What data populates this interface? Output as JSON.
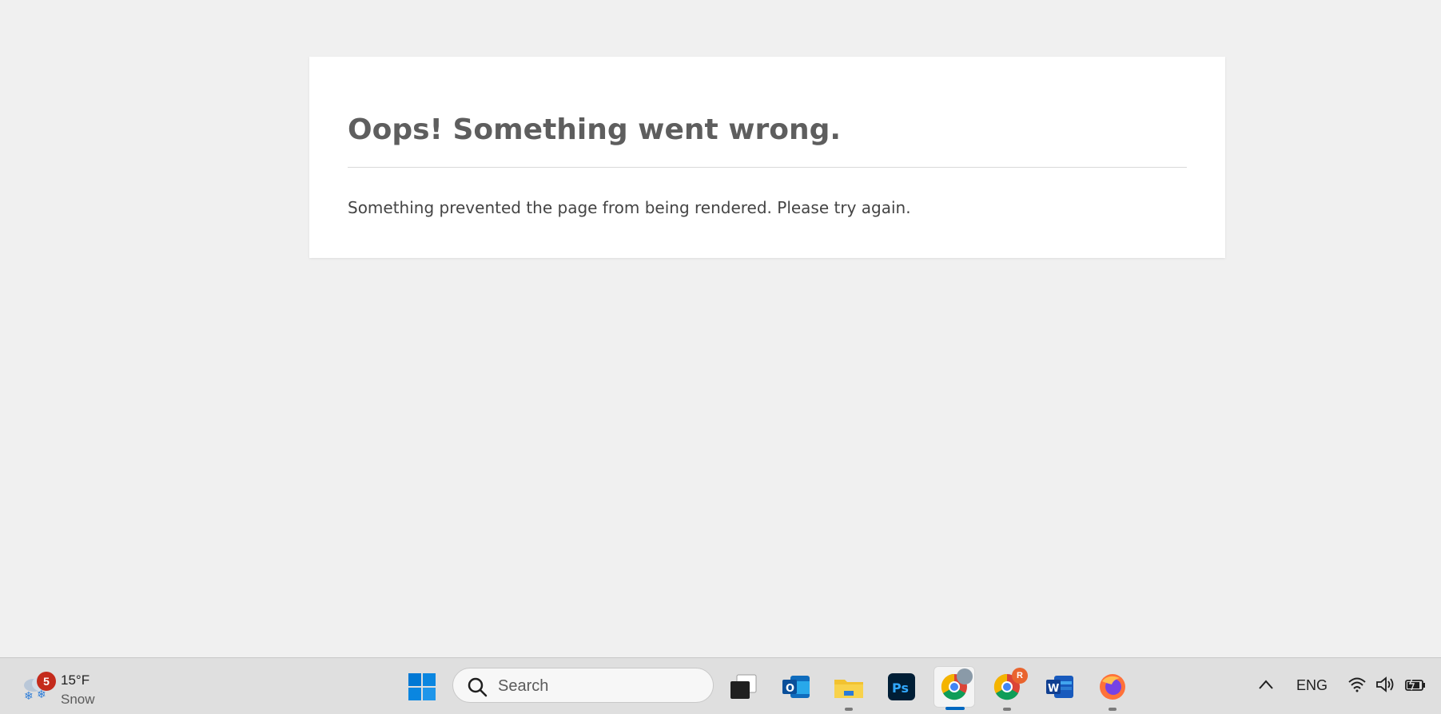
{
  "error_page": {
    "title": "Oops! Something went wrong.",
    "message": "Something prevented the page from being rendered. Please try again."
  },
  "taskbar": {
    "weather": {
      "temperature": "15°F",
      "condition": "Snow",
      "notification_count": "5",
      "icon": "snow-cloud-icon"
    },
    "search": {
      "placeholder": "Search"
    },
    "apps": [
      {
        "name": "Windows Start",
        "icon": "windows-start-icon"
      },
      {
        "name": "Task View",
        "icon": "task-view-icon"
      },
      {
        "name": "Outlook",
        "icon": "outlook-icon"
      },
      {
        "name": "File Explorer",
        "icon": "file-explorer-icon"
      },
      {
        "name": "Photoshop",
        "icon": "photoshop-icon",
        "label": "Ps"
      },
      {
        "name": "Chrome",
        "icon": "chrome-icon"
      },
      {
        "name": "Chrome Profile R",
        "icon": "chrome-icon",
        "badge": "R"
      },
      {
        "name": "Word",
        "icon": "word-icon",
        "label": "W"
      },
      {
        "name": "Firefox",
        "icon": "firefox-icon"
      }
    ],
    "tray": {
      "language": "ENG",
      "icons": [
        "chevron-up-icon",
        "wifi-icon",
        "volume-icon",
        "battery-icon"
      ]
    }
  },
  "colors": {
    "background": "#f0f0f0",
    "card": "#ffffff",
    "title_text": "#5e5e5e",
    "body_text": "#444444",
    "taskbar": "#dfdfdf",
    "active_indicator": "#0067c0",
    "notification_badge": "#c42b1c"
  }
}
